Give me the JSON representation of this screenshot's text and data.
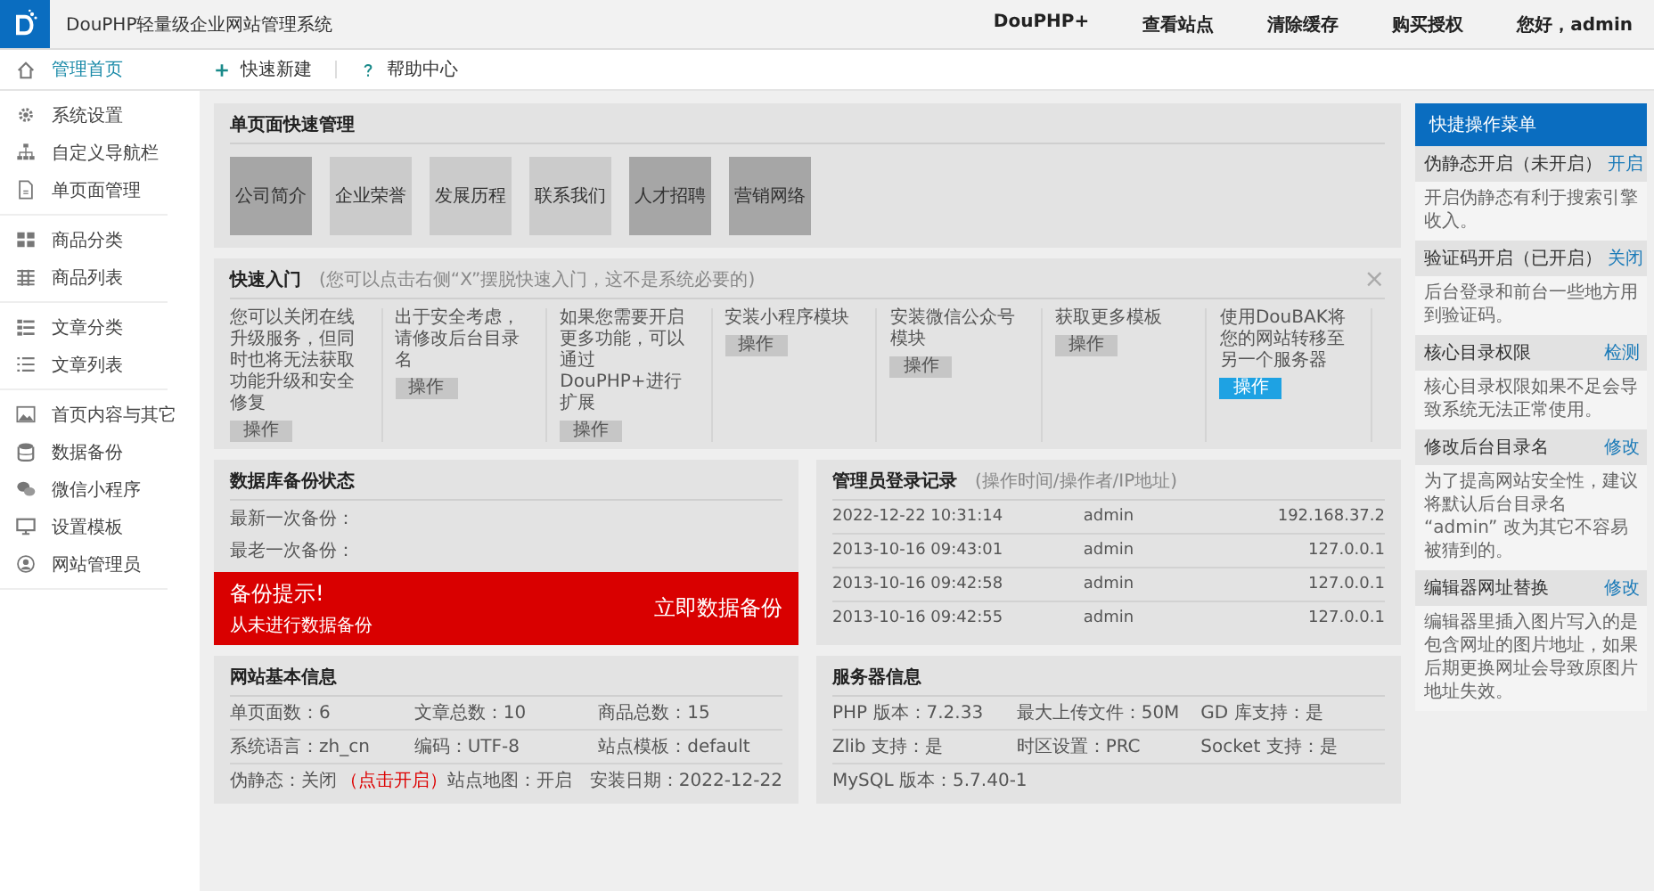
{
  "header": {
    "title": "DouPHP轻量级企业网站管理系统",
    "nav": [
      "DouPHP+",
      "查看站点",
      "清除缓存",
      "购买授权",
      "您好，admin"
    ]
  },
  "sidebar": {
    "groups": [
      {
        "items": [
          {
            "label": "管理首页",
            "kind": "home",
            "selected": true
          }
        ]
      },
      {
        "items": [
          {
            "label": "系统设置",
            "kind": "gear",
            "selected": false
          },
          {
            "label": "自定义导航栏",
            "kind": "sitemap",
            "selected": false
          },
          {
            "label": "单页面管理",
            "kind": "page",
            "selected": false
          }
        ]
      },
      {
        "items": [
          {
            "label": "商品分类",
            "kind": "grid",
            "selected": false
          },
          {
            "label": "商品列表",
            "kind": "table",
            "selected": false
          }
        ]
      },
      {
        "items": [
          {
            "label": "文章分类",
            "kind": "rows",
            "selected": false
          },
          {
            "label": "文章列表",
            "kind": "list",
            "selected": false
          }
        ]
      },
      {
        "items": [
          {
            "label": "首页内容与其它",
            "kind": "image",
            "selected": false
          },
          {
            "label": "数据备份",
            "kind": "database",
            "selected": false
          },
          {
            "label": "微信小程序",
            "kind": "chat",
            "selected": false
          },
          {
            "label": "设置模板",
            "kind": "monitor",
            "selected": false
          },
          {
            "label": "网站管理员",
            "kind": "user",
            "selected": false
          }
        ]
      }
    ]
  },
  "toolbar": [
    {
      "label": "快速新建",
      "kind": "plus"
    },
    {
      "label": "帮助中心",
      "kind": "help"
    }
  ],
  "page_panel": {
    "title": "单页面快速管理",
    "tiles": [
      {
        "label": "公司简介",
        "color": "#a6a6a6"
      },
      {
        "label": "企业荣誉",
        "color": "#cbcbcb"
      },
      {
        "label": "发展历程",
        "color": "#cbcbcb"
      },
      {
        "label": "联系我们",
        "color": "#cbcbcb"
      },
      {
        "label": "人才招聘",
        "color": "#a6a6a6"
      },
      {
        "label": "营销网络",
        "color": "#a6a6a6"
      }
    ]
  },
  "quick_start": {
    "title": "快速入门",
    "hint": "(您可以点击右侧“X”摆脱快速入门，这不是系统必要的)",
    "close": "×",
    "items": [
      {
        "text": "您可以关闭在线升级服务，但同时也将无法获取功能升级和安全修复",
        "button": "操作",
        "highlighted": false
      },
      {
        "text": "出于安全考虑，请修改后台目录名",
        "button": "操作",
        "highlighted": false
      },
      {
        "text": "如果您需要开启更多功能，可以通过DouPHP+进行扩展",
        "button": "操作",
        "highlighted": false
      },
      {
        "text": "安装小程序模块",
        "button": "操作",
        "highlighted": false
      },
      {
        "text": "安装微信公众号模块",
        "button": "操作",
        "highlighted": false
      },
      {
        "text": "获取更多模板",
        "button": "操作",
        "highlighted": false
      },
      {
        "text": "使用DouBAK将您的网站转移至另一个服务器",
        "button": "操作",
        "highlighted": true
      }
    ]
  },
  "backup": {
    "title": "数据库备份状态",
    "lines": [
      "最新一次备份：",
      "最老一次备份："
    ],
    "alert": {
      "title": "备份提示!",
      "message": "从未进行数据备份",
      "action": "立即数据备份"
    }
  },
  "login_log": {
    "title": "管理员登录记录",
    "hint": "(操作时间/操作者/IP地址)",
    "rows": [
      [
        "2022-12-22 10:31:14",
        "admin",
        "192.168.37.2"
      ],
      [
        "2013-10-16 09:43:01",
        "admin",
        "127.0.0.1"
      ],
      [
        "2013-10-16 09:42:58",
        "admin",
        "127.0.0.1"
      ],
      [
        "2013-10-16 09:42:55",
        "admin",
        "127.0.0.1"
      ]
    ]
  },
  "site_info": {
    "title": "网站基本信息",
    "rows": [
      [
        {
          "text": "单页面数：6"
        },
        {
          "text": "文章总数：10"
        },
        {
          "text": "商品总数：15"
        }
      ],
      [
        {
          "text": "系统语言：zh_cn"
        },
        {
          "text": "编码：UTF-8"
        },
        {
          "text": "站点模板：default"
        }
      ],
      [
        {
          "text": "伪静态：关闭",
          "link": "（点击开启）"
        },
        {
          "text": "站点地图：开启"
        },
        {
          "text": "安装日期：2022-12-22"
        }
      ]
    ]
  },
  "server_info": {
    "title": "服务器信息",
    "rows": [
      [
        "PHP 版本：7.2.33",
        "最大上传文件：50M",
        "GD 库支持：是"
      ],
      [
        "Zlib 支持：是",
        "时区设置：PRC",
        "Socket 支持：是"
      ],
      [
        "MySQL 版本：5.7.40-1"
      ]
    ]
  },
  "quick_menu": {
    "title": "快捷操作菜单",
    "items": [
      {
        "title": "伪静态开启（未开启）",
        "action": "开启",
        "desc": "开启伪静态有利于搜索引擎收入。"
      },
      {
        "title": "验证码开启（已开启）",
        "action": "关闭",
        "desc": "后台登录和前台一些地方用到验证码。"
      },
      {
        "title": "核心目录权限",
        "action": "检测",
        "desc": "核心目录权限如果不足会导致系统无法正常使用。"
      },
      {
        "title": "修改后台目录名",
        "action": "修改",
        "desc": "为了提高网站安全性，建议将默认后台目录名 “admin” 改为其它不容易被猜到的。"
      },
      {
        "title": "编辑器网址替换",
        "action": "修改",
        "desc": "编辑器里插入图片写入的是包含网址的图片地址，如果后期更换网址会导致原图片地址失效。"
      }
    ]
  }
}
